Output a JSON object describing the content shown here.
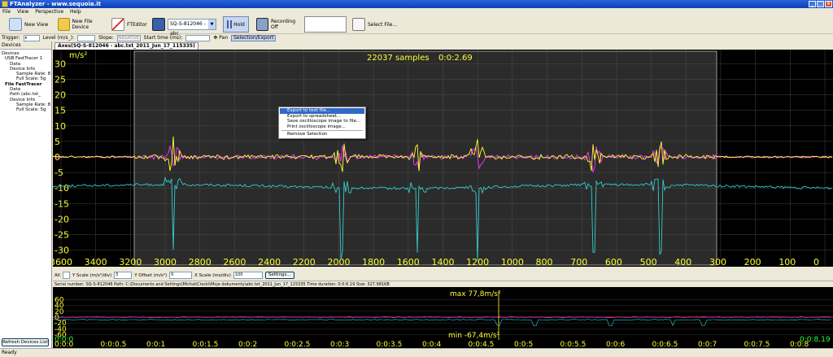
{
  "window": {
    "title": "FTAnalyzer - www.sequoia.it"
  },
  "menu": [
    "File",
    "View",
    "Perspective",
    "Help"
  ],
  "toolbar": {
    "new_view": "New View",
    "new_file_device": "New File Device",
    "fteditor": "FTEditor",
    "device_combo": "SQ-S-812046 - abc",
    "hold": "Hold",
    "recording": "Recording Off",
    "select_file": "Select File..."
  },
  "trigger_bar": {
    "trigger": "Trigger:",
    "level": "Level (m/s_):",
    "slope": "Slope:",
    "slope_value": "NEGATIVE",
    "start_time": "Start time (ms):",
    "pan": "Pan",
    "selection": "Selection/Export"
  },
  "sidebar": {
    "header": "Devices",
    "tree": [
      "Devices",
      "USB FastTracer 1",
      "Data",
      "Device Info",
      "Sample Rate: 8",
      "Full Scale: 5g",
      "File FastTracer",
      "Data",
      "Path (abc.txt_",
      "Device Info",
      "Sample Rate: 8",
      "Full Scale: 5g"
    ],
    "refresh": "Refresh Devices List"
  },
  "tab": {
    "label": "Axes(SQ-S-812046 - abc.txt_2011_Jun_17_115335)"
  },
  "scope": {
    "unit": "m/s²",
    "samples": "22037 samples",
    "time": "0:0:2.69"
  },
  "context_menu": {
    "items": [
      "Export to text file...",
      "Export to spreadsheet...",
      "Save oscilloscope image to file...",
      "Print oscilloscope image...",
      "Remove Selection"
    ]
  },
  "controls": {
    "all": "All",
    "yscale": "Y Scale (m/s²/div)",
    "yscale_value": "5",
    "yoffset": "Y Offset (m/s²)",
    "yoffset_value": "0",
    "xscale": "X Scale (ms/div)",
    "xscale_value": "100",
    "settings": "Settings..."
  },
  "infobar": "Serial number: SQ-S-812046   Path: C:\\Documents and Settings\\Michal\\Ciocki\\Moje dokumenty\\abc.txt_2011_Jun_17_115335   Time duration: 0:0:6.19   Size: 327.981KB",
  "overview": {
    "max": "max 77,8m/s²",
    "min": "min -67,4m/s²",
    "left_label": "0:0:0",
    "end_label": "0:0:8.19"
  },
  "status": "Ready",
  "chart_data": [
    {
      "type": "line",
      "title": "",
      "ylabel": "m/s²",
      "ylim": [
        -33,
        33
      ],
      "yticks": [
        30,
        25,
        20,
        15,
        10,
        5,
        0,
        -5,
        -10,
        -15,
        -20,
        -25,
        -30
      ],
      "xticks": [
        3600,
        3400,
        3200,
        3000,
        2800,
        2600,
        2400,
        2200,
        2000,
        1800,
        1600,
        1400,
        1200,
        1000,
        800,
        700,
        600,
        500,
        400,
        300,
        200,
        100,
        0
      ],
      "series_colors": [
        "#ff33ff",
        "#ffff33",
        "#33cccc"
      ],
      "series": [
        {
          "values_baseline": [
            0,
            0,
            0,
            0,
            0,
            0,
            0,
            0,
            0,
            0
          ]
        },
        {
          "values_baseline": [
            0,
            0,
            0,
            0,
            0,
            0,
            0,
            0,
            0,
            0
          ]
        },
        {
          "values_baseline": [
            -9.5,
            -9.8,
            -9.4,
            -9.2,
            -9.6,
            -9.3,
            -9.1,
            -9.0,
            -9.2,
            -9.5
          ]
        }
      ]
    },
    {
      "type": "line",
      "title": "",
      "yticks": [
        60,
        40,
        20,
        0,
        -20,
        -40,
        -60
      ],
      "xticks": [
        "0:0:0",
        "0:0:0.5",
        "0:0:1",
        "0:0:1.5",
        "0:0:2",
        "0:0:2.5",
        "0:0:3",
        "0:0:3.5",
        "0:0:4",
        "0:0:4.5",
        "0:0:5",
        "0:0:5.5",
        "0:0:6",
        "0:0:6.5",
        "0:0:7",
        "0:0:7.5",
        "0:0:8"
      ]
    }
  ]
}
